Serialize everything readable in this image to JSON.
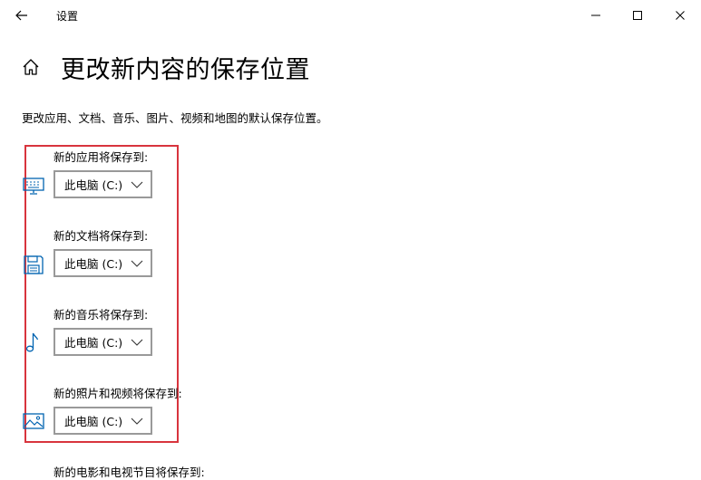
{
  "window": {
    "title": "设置"
  },
  "page": {
    "title": "更改新内容的保存位置",
    "description": "更改应用、文档、音乐、图片、视频和地图的默认保存位置。"
  },
  "sections": [
    {
      "label": "新的应用将保存到:",
      "value": "此电脑 (C:)",
      "icon": "monitor-icon"
    },
    {
      "label": "新的文档将保存到:",
      "value": "此电脑 (C:)",
      "icon": "document-drive-icon"
    },
    {
      "label": "新的音乐将保存到:",
      "value": "此电脑 (C:)",
      "icon": "music-note-icon"
    },
    {
      "label": "新的照片和视频将保存到:",
      "value": "此电脑 (C:)",
      "icon": "picture-icon"
    },
    {
      "label": "新的电影和电视节目将保存到:"
    }
  ],
  "colors": {
    "accent": "#0063b1",
    "highlight_border": "#d8343d",
    "dropdown_border": "#999999"
  }
}
